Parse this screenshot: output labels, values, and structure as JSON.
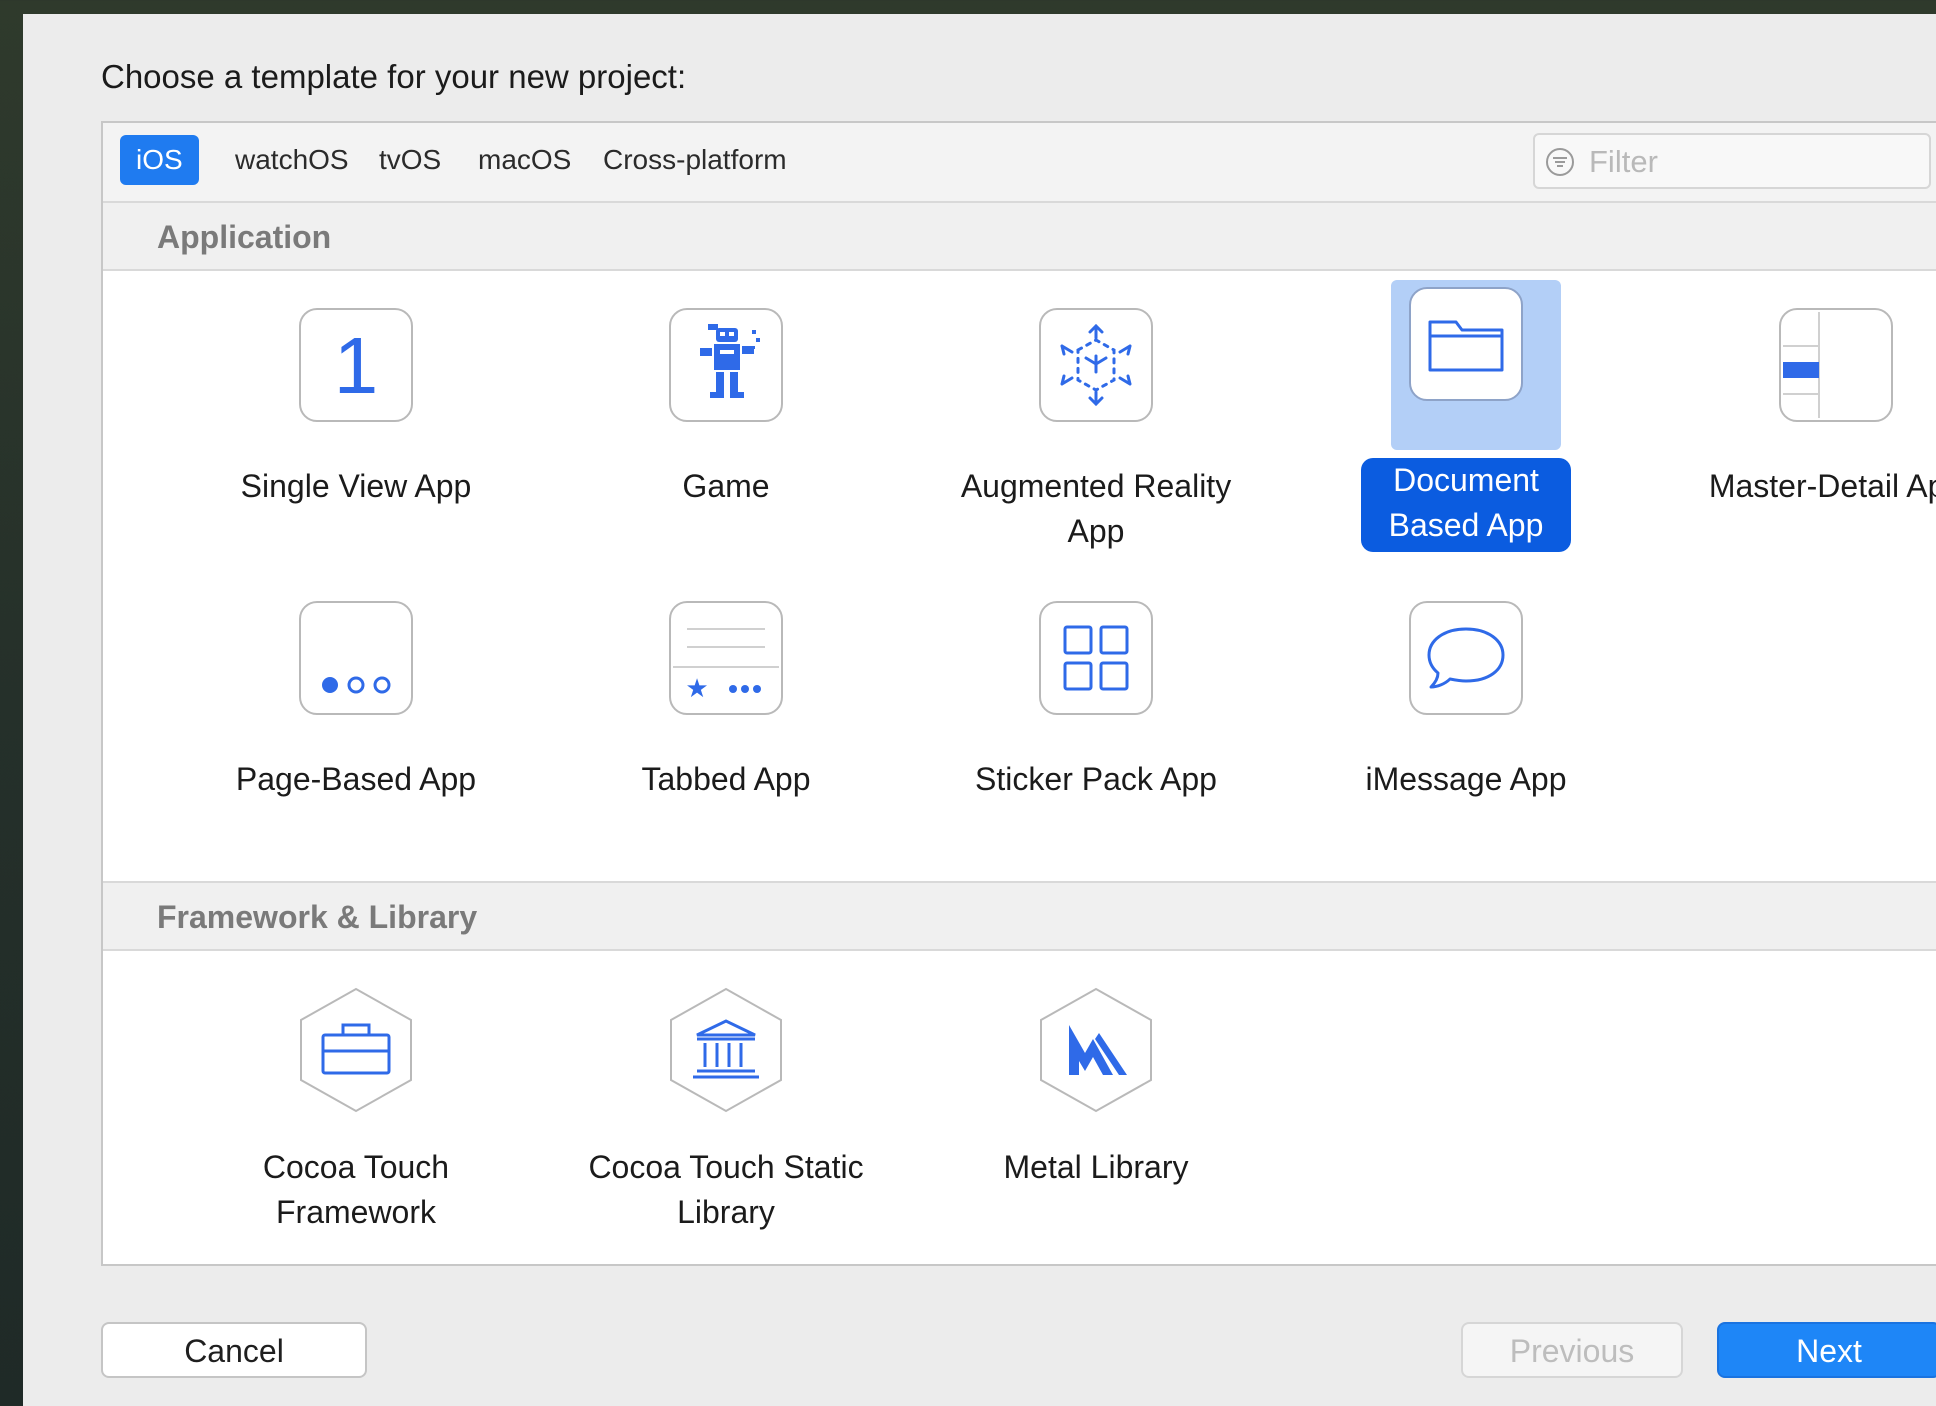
{
  "dialog": {
    "heading": "Choose a template for your new project:",
    "accent_color": "#1f7bf0"
  },
  "platform_tabs": [
    {
      "label": "iOS",
      "selected": true
    },
    {
      "label": "watchOS",
      "selected": false
    },
    {
      "label": "tvOS",
      "selected": false
    },
    {
      "label": "macOS",
      "selected": false
    },
    {
      "label": "Cross-platform",
      "selected": false
    }
  ],
  "filter": {
    "placeholder": "Filter",
    "icon": "filter-icon"
  },
  "sections": [
    {
      "title": "Application",
      "templates": [
        {
          "label": "Single View App",
          "icon": "single-view-icon",
          "selected": false
        },
        {
          "label": "Game",
          "icon": "game-icon",
          "selected": false
        },
        {
          "label": "Augmented Reality App",
          "icon": "augmented-reality-icon",
          "selected": false
        },
        {
          "label": "Document Based App",
          "icon": "folder-icon",
          "selected": true
        },
        {
          "label": "Master-Detail App",
          "icon": "master-detail-icon",
          "selected": false
        },
        {
          "label": "Page-Based App",
          "icon": "page-dots-icon",
          "selected": false
        },
        {
          "label": "Tabbed App",
          "icon": "tab-bar-icon",
          "selected": false
        },
        {
          "label": "Sticker Pack App",
          "icon": "sticker-grid-icon",
          "selected": false
        },
        {
          "label": "iMessage App",
          "icon": "speech-bubble-icon",
          "selected": false
        }
      ]
    },
    {
      "title": "Framework & Library",
      "templates": [
        {
          "label": "Cocoa Touch Framework",
          "icon": "toolbox-icon",
          "selected": false
        },
        {
          "label": "Cocoa Touch Static Library",
          "icon": "library-building-icon",
          "selected": false
        },
        {
          "label": "Metal Library",
          "icon": "metal-icon",
          "selected": false
        }
      ]
    }
  ],
  "single_view_digit": "1",
  "buttons": {
    "cancel": "Cancel",
    "previous": "Previous",
    "next": "Next"
  }
}
